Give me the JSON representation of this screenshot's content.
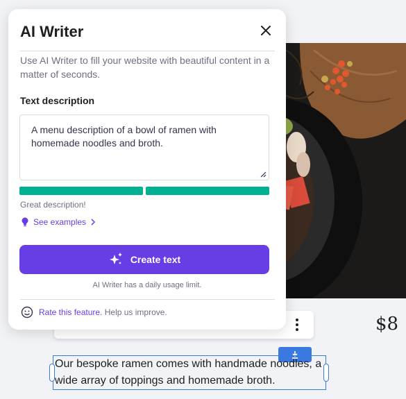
{
  "panel": {
    "title": "AI Writer",
    "intro": "Use AI Writer to fill your website with beautiful content in a matter of seconds.",
    "section_label": "Text description",
    "description": "A menu description of a bowl of ramen with homemade noodles and broth.",
    "quality_fraction": 1.0,
    "quality_text": "Great description!",
    "examples_link": "See examples",
    "create_button": "Create text",
    "limit_note": "AI Writer has a daily usage limit.",
    "rate_link": "Rate this feature.",
    "rate_suffix": "Help us improve."
  },
  "page": {
    "price": "$8",
    "body_text": "Our bespoke ramen comes with handmade noodles, a wide array of toppings and homemade broth."
  },
  "colors": {
    "accent": "#673de6",
    "success": "#00b090",
    "selection": "#3a79e0"
  }
}
